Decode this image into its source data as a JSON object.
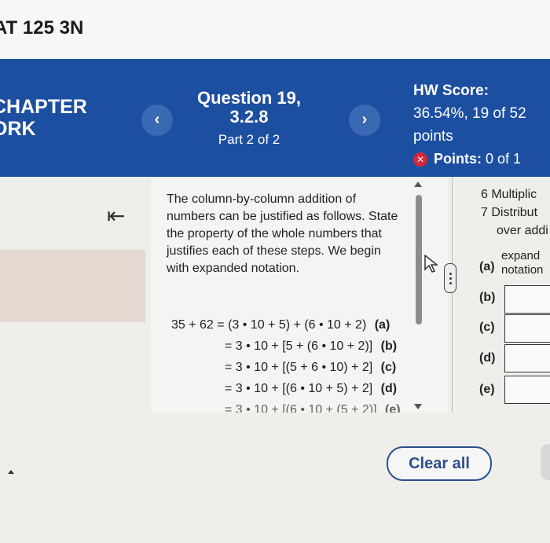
{
  "course": {
    "title": "AT 125 3N"
  },
  "header": {
    "chapter_lines": [
      "CHAPTER",
      "ORK"
    ],
    "prev_label": "‹",
    "next_label": "›",
    "question_title": "Question 19,",
    "question_id": "3.2.8",
    "part": "Part 2 of 2",
    "hw_score_label": "HW Score:",
    "hw_score_value": "36.54%, 19 of 52",
    "hw_score_unit": "points",
    "points_label": "Points:",
    "points_value": "0 of 1"
  },
  "sidebar": {
    "collapse_icon": "collapse-left-icon",
    "collapse_glyph": "⇤"
  },
  "question": {
    "text": "The column-by-column addition of numbers can be justified as follows. State the property of the whole numbers that justifies each of these steps. We begin with expanded notation.",
    "steps": [
      {
        "lhs": "35 + 62 =",
        "expr": "(3 • 10 + 5) + (6 • 10 + 2)",
        "label": "(a)"
      },
      {
        "lhs": "",
        "expr": "= 3 • 10 + [5 + (6 • 10 + 2)]",
        "label": "(b)"
      },
      {
        "lhs": "",
        "expr": "= 3 • 10 + [(5 + 6 • 10) + 2]",
        "label": "(c)"
      },
      {
        "lhs": "",
        "expr": "= 3 • 10 + [(6 • 10 + 5) + 2]",
        "label": "(d)"
      },
      {
        "lhs": "",
        "expr": "= 3 • 10 + [(6 • 10 + (5 + 2)]",
        "label": "(e)"
      }
    ]
  },
  "answers": {
    "options_partial": [
      "6 Multiplic",
      "7 Distribut",
      "over addi"
    ],
    "expand_text": [
      "expand",
      "notation"
    ],
    "labels": [
      "(a)",
      "(b)",
      "(c)",
      "(d)",
      "(e)"
    ]
  },
  "actions": {
    "clear_all": "Clear all"
  },
  "colors": {
    "header_blue": "#1c4fa0",
    "incorrect_red": "#d9263a",
    "button_blue": "#2a4f8f"
  }
}
